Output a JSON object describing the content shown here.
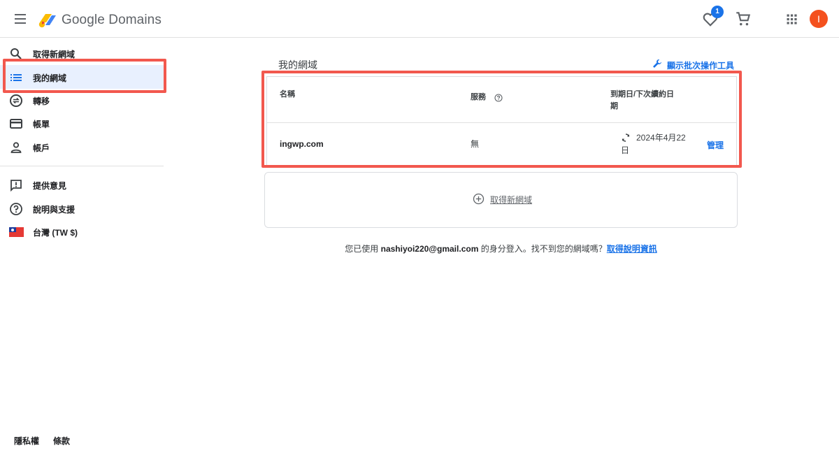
{
  "header": {
    "brand": "Google Domains",
    "favorites_count": "1",
    "avatar_letter": "I"
  },
  "sidebar": {
    "items": [
      {
        "label": "取得新網域",
        "icon": "search-icon"
      },
      {
        "label": "我的網域",
        "icon": "list-icon",
        "active": true
      },
      {
        "label": "轉移",
        "icon": "transfer-icon"
      },
      {
        "label": "帳單",
        "icon": "credit-card-icon"
      },
      {
        "label": "帳戶",
        "icon": "person-icon"
      },
      {
        "label": "提供意見",
        "icon": "feedback-icon"
      },
      {
        "label": "說明與支援",
        "icon": "help-icon"
      },
      {
        "label": "台灣 (TW $)",
        "icon": "taiwan-flag-icon"
      }
    ],
    "footer": {
      "privacy": "隱私權",
      "terms": "條款"
    }
  },
  "main": {
    "title": "我的網域",
    "bulk_tools": "顯示批次操作工具",
    "table": {
      "columns": {
        "name": "名稱",
        "service": "服務",
        "expiry_line1": "到期日/下次續約日",
        "expiry_line2": "期"
      },
      "rows": [
        {
          "name": "ingwp.com",
          "service": "無",
          "expiry_line1": "2024年4月22",
          "expiry_line2": "日",
          "action": "管理"
        }
      ]
    },
    "add_domain": "取得新網域",
    "signed_in": {
      "prefix": "您已使用",
      "email": "nashiyoi220@gmail.com",
      "middle": "的身分登入。找不到您的網域嗎？",
      "link": "取得說明資訊"
    }
  },
  "colors": {
    "accent": "#1a73e8",
    "highlight": "#f2584e",
    "active_bg": "#e8f0fe",
    "avatar": "#f4511e"
  }
}
